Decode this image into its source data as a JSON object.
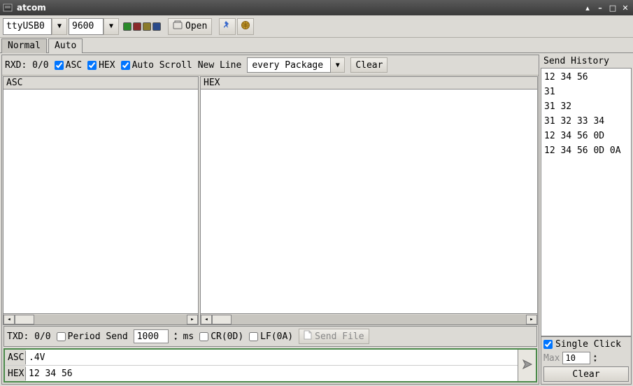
{
  "window": {
    "title": "atcom"
  },
  "toolbar": {
    "port": "ttyUSB0",
    "baud": "9600",
    "open_label": "Open"
  },
  "tabs": {
    "normal": "Normal",
    "auto": "Auto"
  },
  "rx": {
    "label": "RXD: 0/0",
    "asc": "ASC",
    "hex": "HEX",
    "auto_scroll": "Auto Scroll",
    "new_line": "New Line",
    "package_mode": "every Package",
    "clear": "Clear"
  },
  "panes": {
    "asc_header": "ASC",
    "hex_header": "HEX"
  },
  "tx": {
    "label": "TXD: 0/0",
    "period_send": "Period Send",
    "period_ms": "1000",
    "ms": "ms",
    "cr": "CR(0D)",
    "lf": "LF(0A)",
    "send_file": "Send File"
  },
  "send": {
    "asc_label": "ASC",
    "hex_label": "HEX",
    "asc_value": ".4V",
    "hex_value": "12 34 56"
  },
  "side": {
    "history_header": "Send History",
    "history": [
      "12 34 56",
      "31",
      "31 32",
      "31 32 33 34",
      "12 34 56 0D",
      "12 34 56 0D 0A"
    ],
    "single_click": "Single Click",
    "max_label": "Max",
    "max_value": "10",
    "clear": "Clear"
  }
}
